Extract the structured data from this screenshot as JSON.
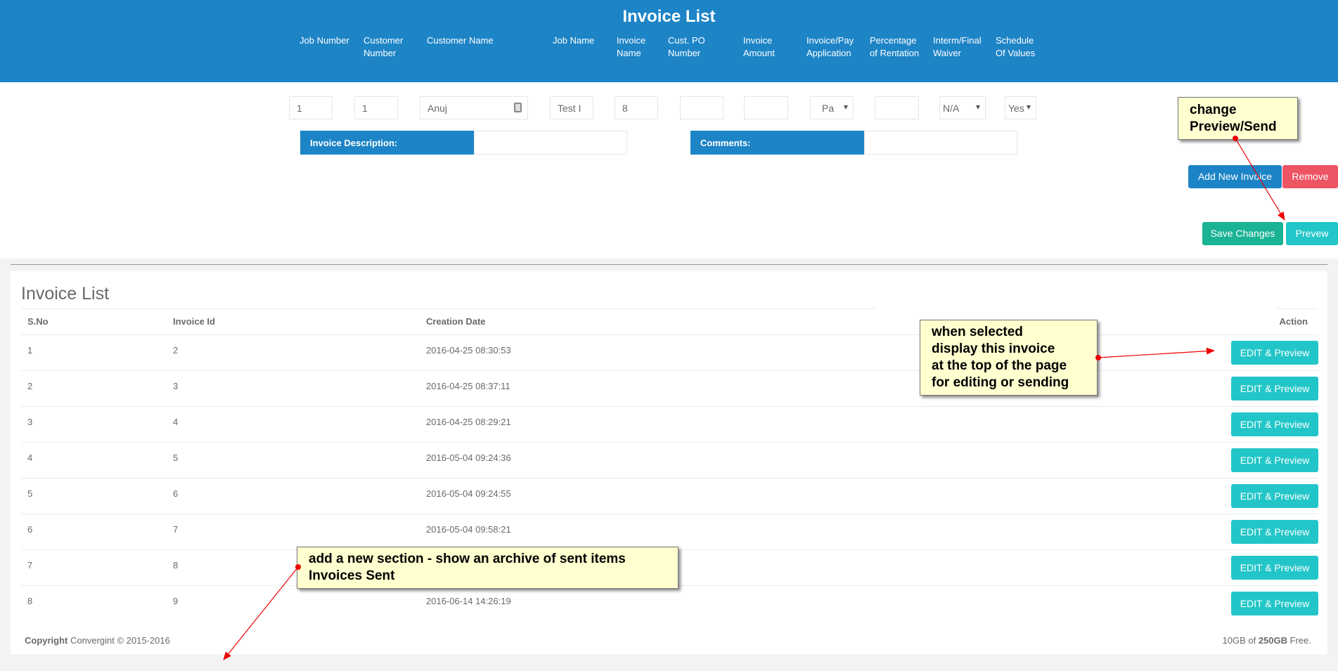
{
  "header": {
    "title": "Invoice List",
    "columns": [
      "Job Number",
      "Customer Number",
      "Customer Name",
      "Job Name",
      "Invoice Name",
      "Cust. PO Number",
      "Invoice Amount",
      "Invoice/Pay Application",
      "Percentage of Rentation",
      "Interm/Final Waiver",
      "Schedule Of Values"
    ]
  },
  "form": {
    "job_number": "1",
    "customer_number": "1",
    "customer_name": "Anuj",
    "job_name": "Test I",
    "invoice_name": "8",
    "cust_po": "",
    "invoice_amount": "",
    "pay_application": "Pa",
    "percentage": "",
    "waiver": "N/A",
    "schedule": "Yes",
    "description_label": "Invoice Description:",
    "comments_label": "Comments:"
  },
  "buttons": {
    "add": "Add New Invoice",
    "remove": "Remove",
    "save": "Save Changes",
    "preview": "Prevew"
  },
  "list": {
    "title": "Invoice List",
    "headers": {
      "sno": "S.No",
      "id": "Invoice Id",
      "date": "Creation Date",
      "action": "Action"
    },
    "rows": [
      {
        "sno": "1",
        "id": "2",
        "date": "2016-04-25 08:30:53",
        "action": "EDIT & Preview"
      },
      {
        "sno": "2",
        "id": "3",
        "date": "2016-04-25 08:37:11",
        "action": "EDIT & Preview"
      },
      {
        "sno": "3",
        "id": "4",
        "date": "2016-04-25 08:29:21",
        "action": "EDIT & Preview"
      },
      {
        "sno": "4",
        "id": "5",
        "date": "2016-05-04 09:24:36",
        "action": "EDIT & Preview"
      },
      {
        "sno": "5",
        "id": "6",
        "date": "2016-05-04 09:24:55",
        "action": "EDIT & Preview"
      },
      {
        "sno": "6",
        "id": "7",
        "date": "2016-05-04 09:58:21",
        "action": "EDIT & Preview"
      },
      {
        "sno": "7",
        "id": "8",
        "date": "",
        "action": "EDIT & Preview"
      },
      {
        "sno": "8",
        "id": "9",
        "date": "2016-06-14 14:26:19",
        "action": "EDIT & Preview"
      }
    ]
  },
  "footer": {
    "copyright_bold": "Copyright",
    "copyright": " Convergint © 2015-2016",
    "storage_pre": "10GB of ",
    "storage_bold": "250GB",
    "storage_post": " Free."
  },
  "notes": {
    "preview": "change\nPreview/Send",
    "edit": "when selected\ndisplay this invoice\nat the top of the page\nfor editing or sending",
    "archive": "add a new section - show an archive of sent items\nInvoices Sent"
  }
}
